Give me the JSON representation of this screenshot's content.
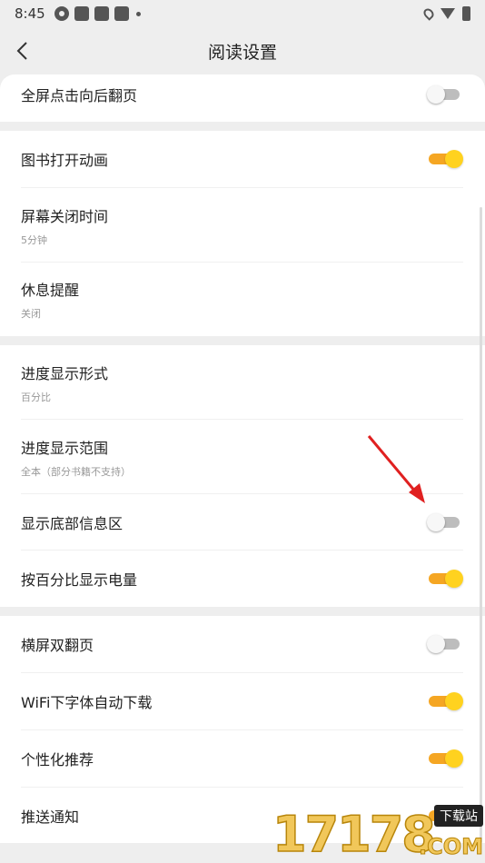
{
  "status_bar": {
    "time": "8:45",
    "icons": [
      "fan-icon",
      "app-icon",
      "app-icon",
      "app-icon",
      "dot-icon",
      "location-icon",
      "wifi-icon",
      "battery-icon"
    ]
  },
  "header": {
    "title": "阅读设置",
    "back_icon": "chevron-left-icon"
  },
  "sections": [
    {
      "items": [
        {
          "title": "全屏点击向后翻页",
          "type": "toggle",
          "on": false
        }
      ]
    },
    {
      "items": [
        {
          "title": "图书打开动画",
          "type": "toggle",
          "on": true
        },
        {
          "title": "屏幕关闭时间",
          "subtitle": "5分钟",
          "type": "value"
        },
        {
          "title": "休息提醒",
          "subtitle": "关闭",
          "type": "value"
        }
      ]
    },
    {
      "items": [
        {
          "title": "进度显示形式",
          "subtitle": "百分比",
          "type": "value"
        },
        {
          "title": "进度显示范围",
          "subtitle": "全本（部分书籍不支持）",
          "type": "value"
        },
        {
          "title": "显示底部信息区",
          "type": "toggle",
          "on": false
        },
        {
          "title": "按百分比显示电量",
          "type": "toggle",
          "on": true
        }
      ]
    },
    {
      "items": [
        {
          "title": "横屏双翻页",
          "type": "toggle",
          "on": false
        },
        {
          "title": "WiFi下字体自动下载",
          "type": "toggle",
          "on": true
        },
        {
          "title": "个性化推荐",
          "type": "toggle",
          "on": true
        },
        {
          "title": "推送通知",
          "type": "toggle",
          "on": true
        }
      ]
    }
  ],
  "watermark": {
    "number": "17178",
    "badge": "下载站",
    "suffix": ".COM"
  },
  "colors": {
    "toggle_on_track": "#f5a623",
    "toggle_on_thumb": "#ffd21f",
    "toggle_off_track": "#bdbdbd",
    "annotation_arrow": "#e02020"
  }
}
